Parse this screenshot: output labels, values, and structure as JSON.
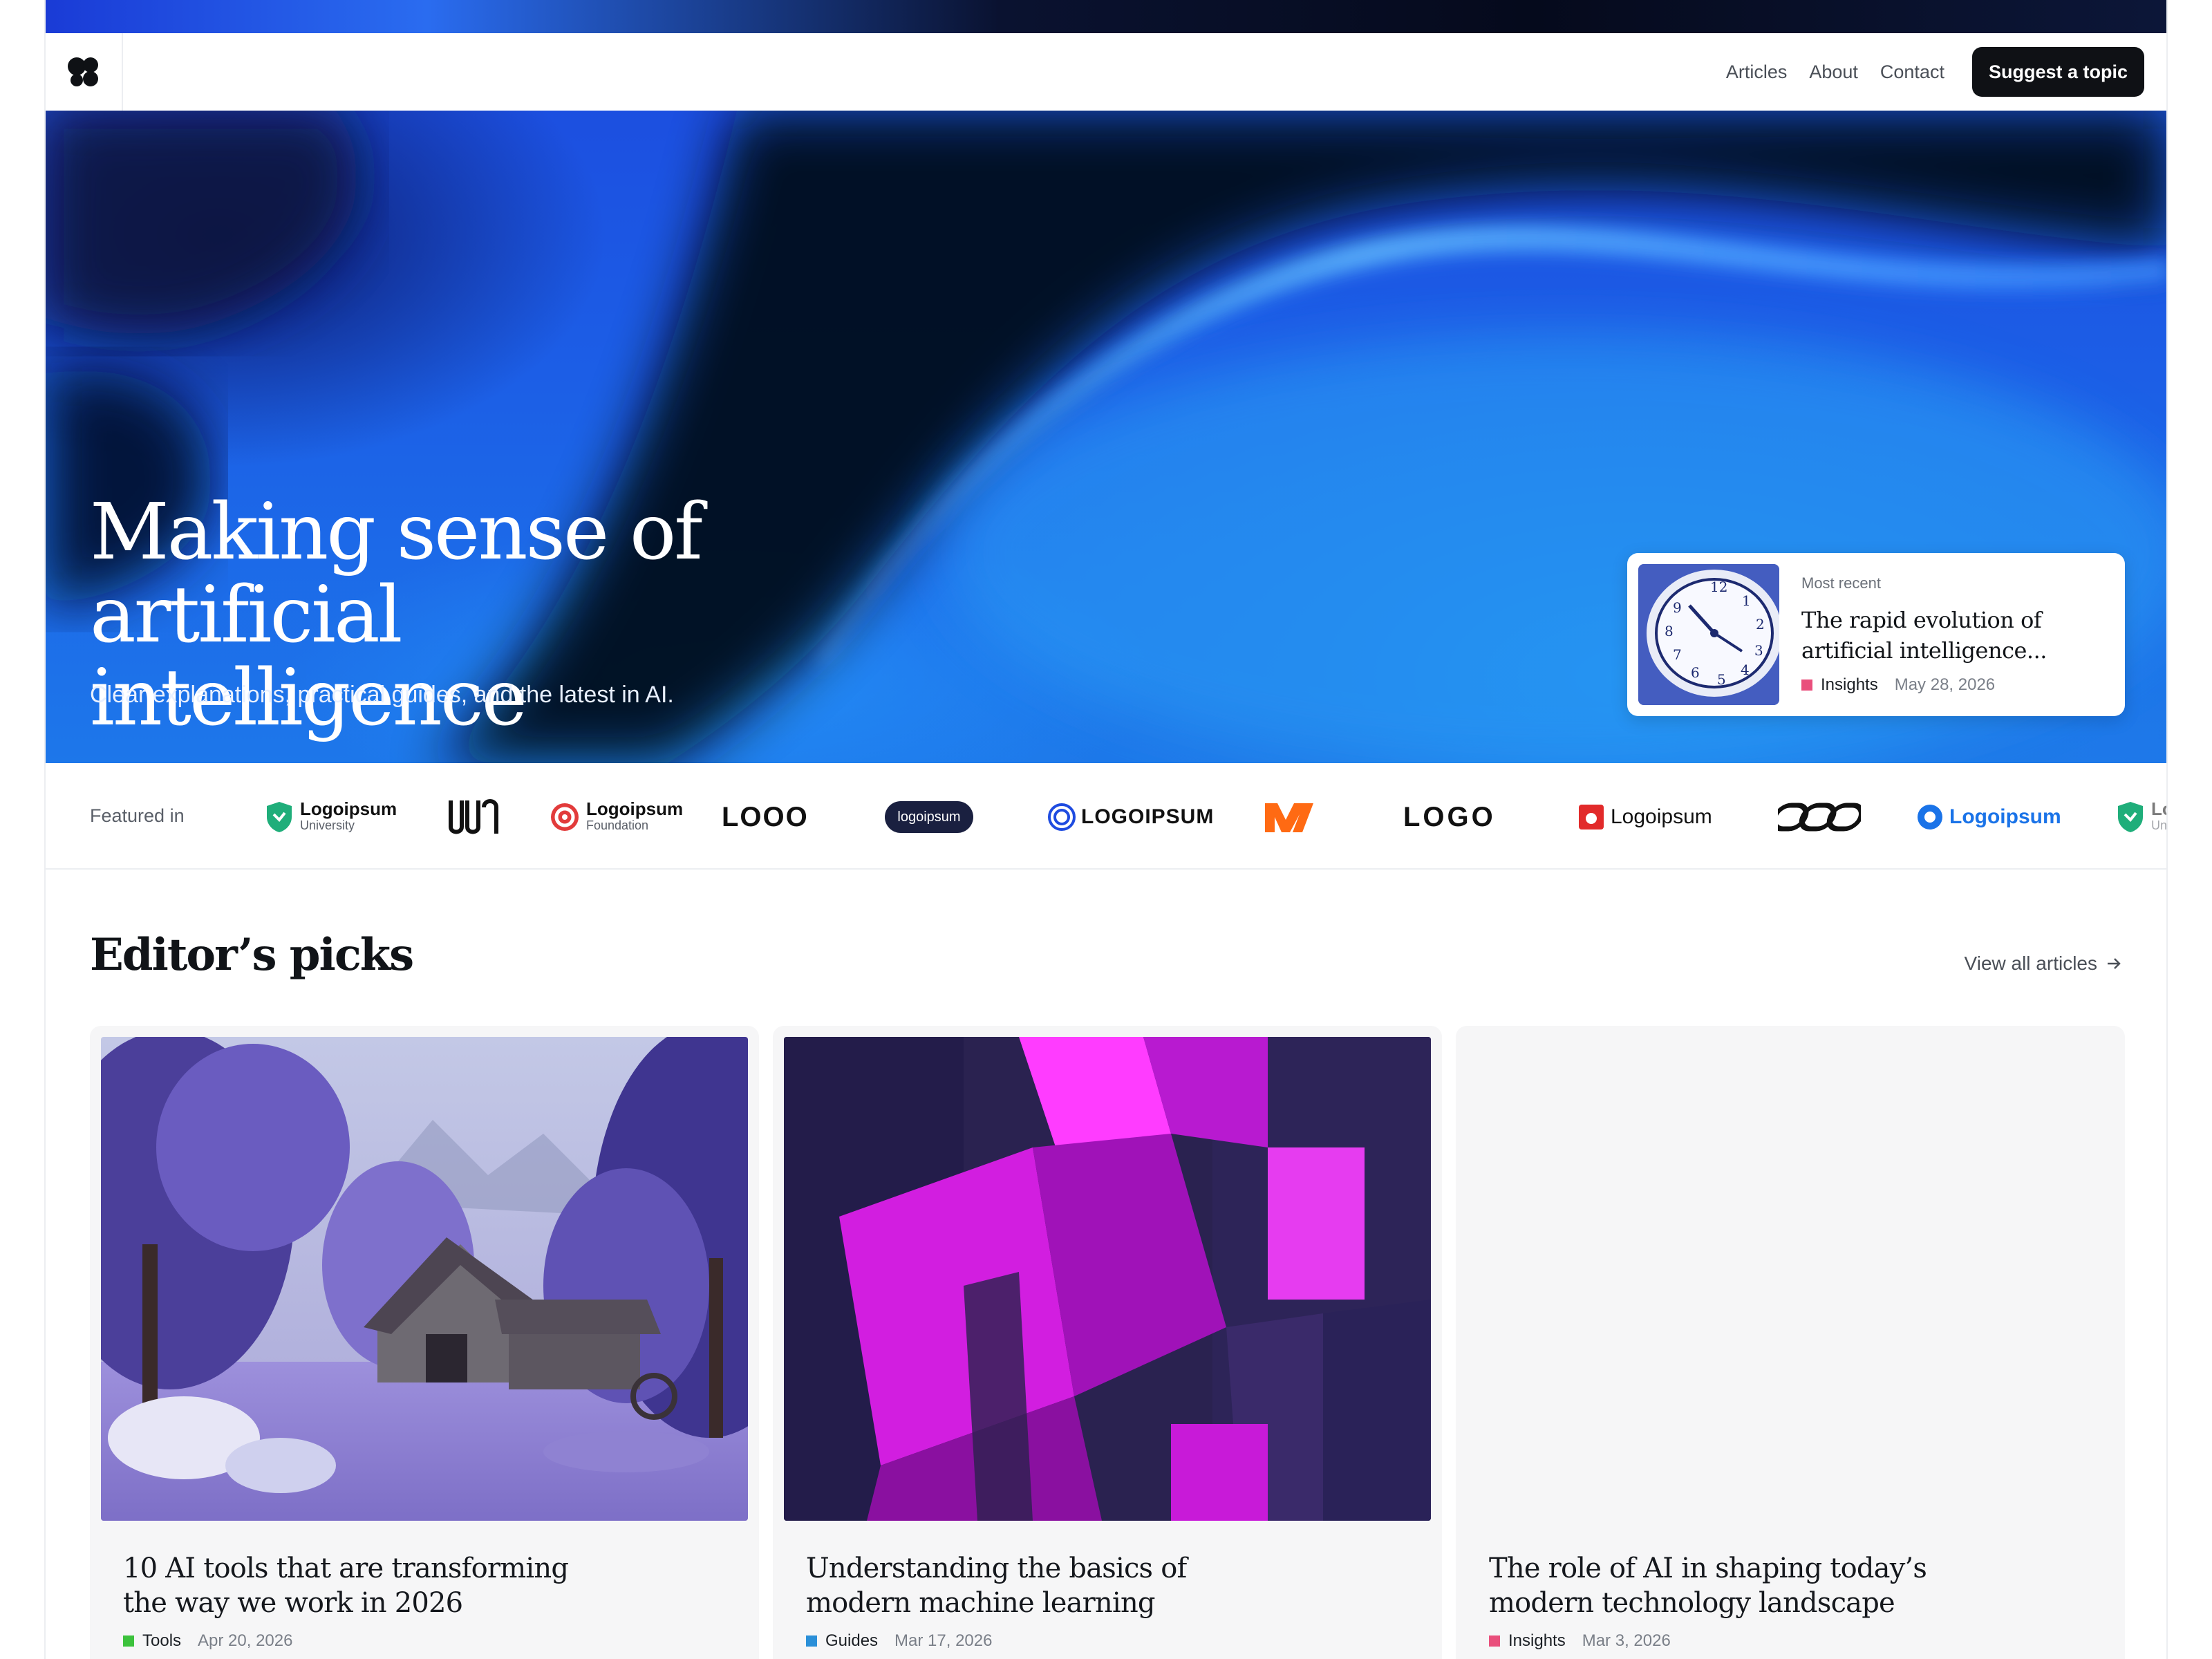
{
  "nav": {
    "logo_icon": "brand-blob-icon",
    "links": [
      {
        "label": "Articles"
      },
      {
        "label": "About"
      },
      {
        "label": "Contact"
      }
    ],
    "cta_label": "Suggest a topic"
  },
  "hero": {
    "title": "Making sense of artificial intelligence",
    "subtitle": "Clear explanations, practical guides, and the latest in AI."
  },
  "most_recent": {
    "label": "Most recent",
    "title": "The rapid evolution of artificial intelligence...",
    "category": "Insights",
    "category_color": "#e94f7c",
    "date": "May 28, 2026",
    "thumbnail_icon": "clock-image"
  },
  "featured": {
    "label": "Featured in",
    "logos": [
      {
        "name": "Logoipsum",
        "sub": "University",
        "color": "#1fae7a"
      },
      {
        "name": "logo-mark-1"
      },
      {
        "name": "Logoipsum",
        "sub": "Foundation",
        "color": "#e23b3b"
      },
      {
        "name": "LOOO"
      },
      {
        "name": "logoipsum"
      },
      {
        "name": "LOGOIPSUM",
        "color": "#1e4be0"
      },
      {
        "name": "logo-mark-orange",
        "color": "#ff6a13"
      },
      {
        "name": "LOGO"
      },
      {
        "name": "Logoipsum",
        "color": "#e22a2a"
      },
      {
        "name": "logo-mark-links"
      },
      {
        "name": "Logoipsum",
        "color": "#1a73e8"
      },
      {
        "name": "Logoips",
        "sub": "Universi",
        "color": "#1fae7a"
      }
    ]
  },
  "picks": {
    "title": "Editor’s picks",
    "view_all": "View all articles",
    "cards": [
      {
        "title": "10 AI tools that are transforming the way we work in 2026",
        "category": "Tools",
        "category_color": "#3cc23c",
        "date": "Apr 20, 2026"
      },
      {
        "title": "Understanding the basics of modern machine learning",
        "category": "Guides",
        "category_color": "#2a8fd8",
        "date": "Mar 17, 2026"
      },
      {
        "title": "The role of AI in shaping today’s modern technology landscape",
        "category": "Insights",
        "category_color": "#e94f7c",
        "date": "Mar 3, 2026"
      }
    ]
  }
}
